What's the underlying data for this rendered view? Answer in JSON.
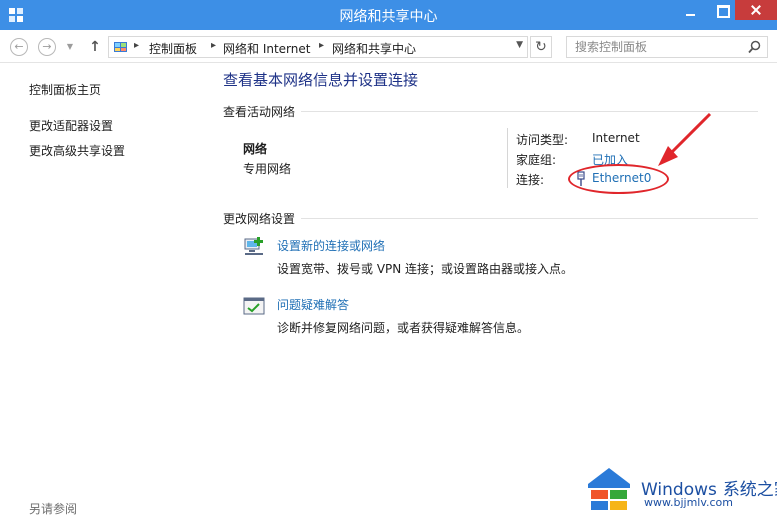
{
  "window": {
    "title": "网络和共享中心"
  },
  "address_bar": {
    "breadcrumbs": [
      "控制面板",
      "网络和 Internet",
      "网络和共享中心"
    ],
    "search_placeholder": "搜索控制面板"
  },
  "sidebar": {
    "items": [
      {
        "label": "控制面板主页"
      },
      {
        "label": "更改适配器设置"
      },
      {
        "label": "更改高级共享设置"
      }
    ],
    "see_also": "另请参阅"
  },
  "main": {
    "title": "查看基本网络信息并设置连接",
    "active_section": "查看活动网络",
    "network": {
      "name": "网络",
      "type": "专用网络",
      "access_type_label": "访问类型:",
      "access_type_value": "Internet",
      "homegroup_label": "家庭组:",
      "homegroup_value": "已加入",
      "connection_label": "连接:",
      "connection_value": "Ethernet0"
    },
    "change_section": "更改网络设置",
    "tasks": [
      {
        "link": "设置新的连接或网络",
        "desc": "设置宽带、拨号或 VPN 连接；或设置路由器或接入点。"
      },
      {
        "link": "问题疑难解答",
        "desc": "诊断并修复网络问题，或者获得疑难解答信息。"
      }
    ]
  },
  "watermark": {
    "brand": "Windows",
    "brand_suffix": "系统之家",
    "url": "www.bjjmlv.com"
  },
  "colors": {
    "titlebar": "#3d8fe6",
    "close": "#c73c3c",
    "link": "#1f6fb5",
    "heading": "#1e3287",
    "annotation": "#e0262b"
  }
}
